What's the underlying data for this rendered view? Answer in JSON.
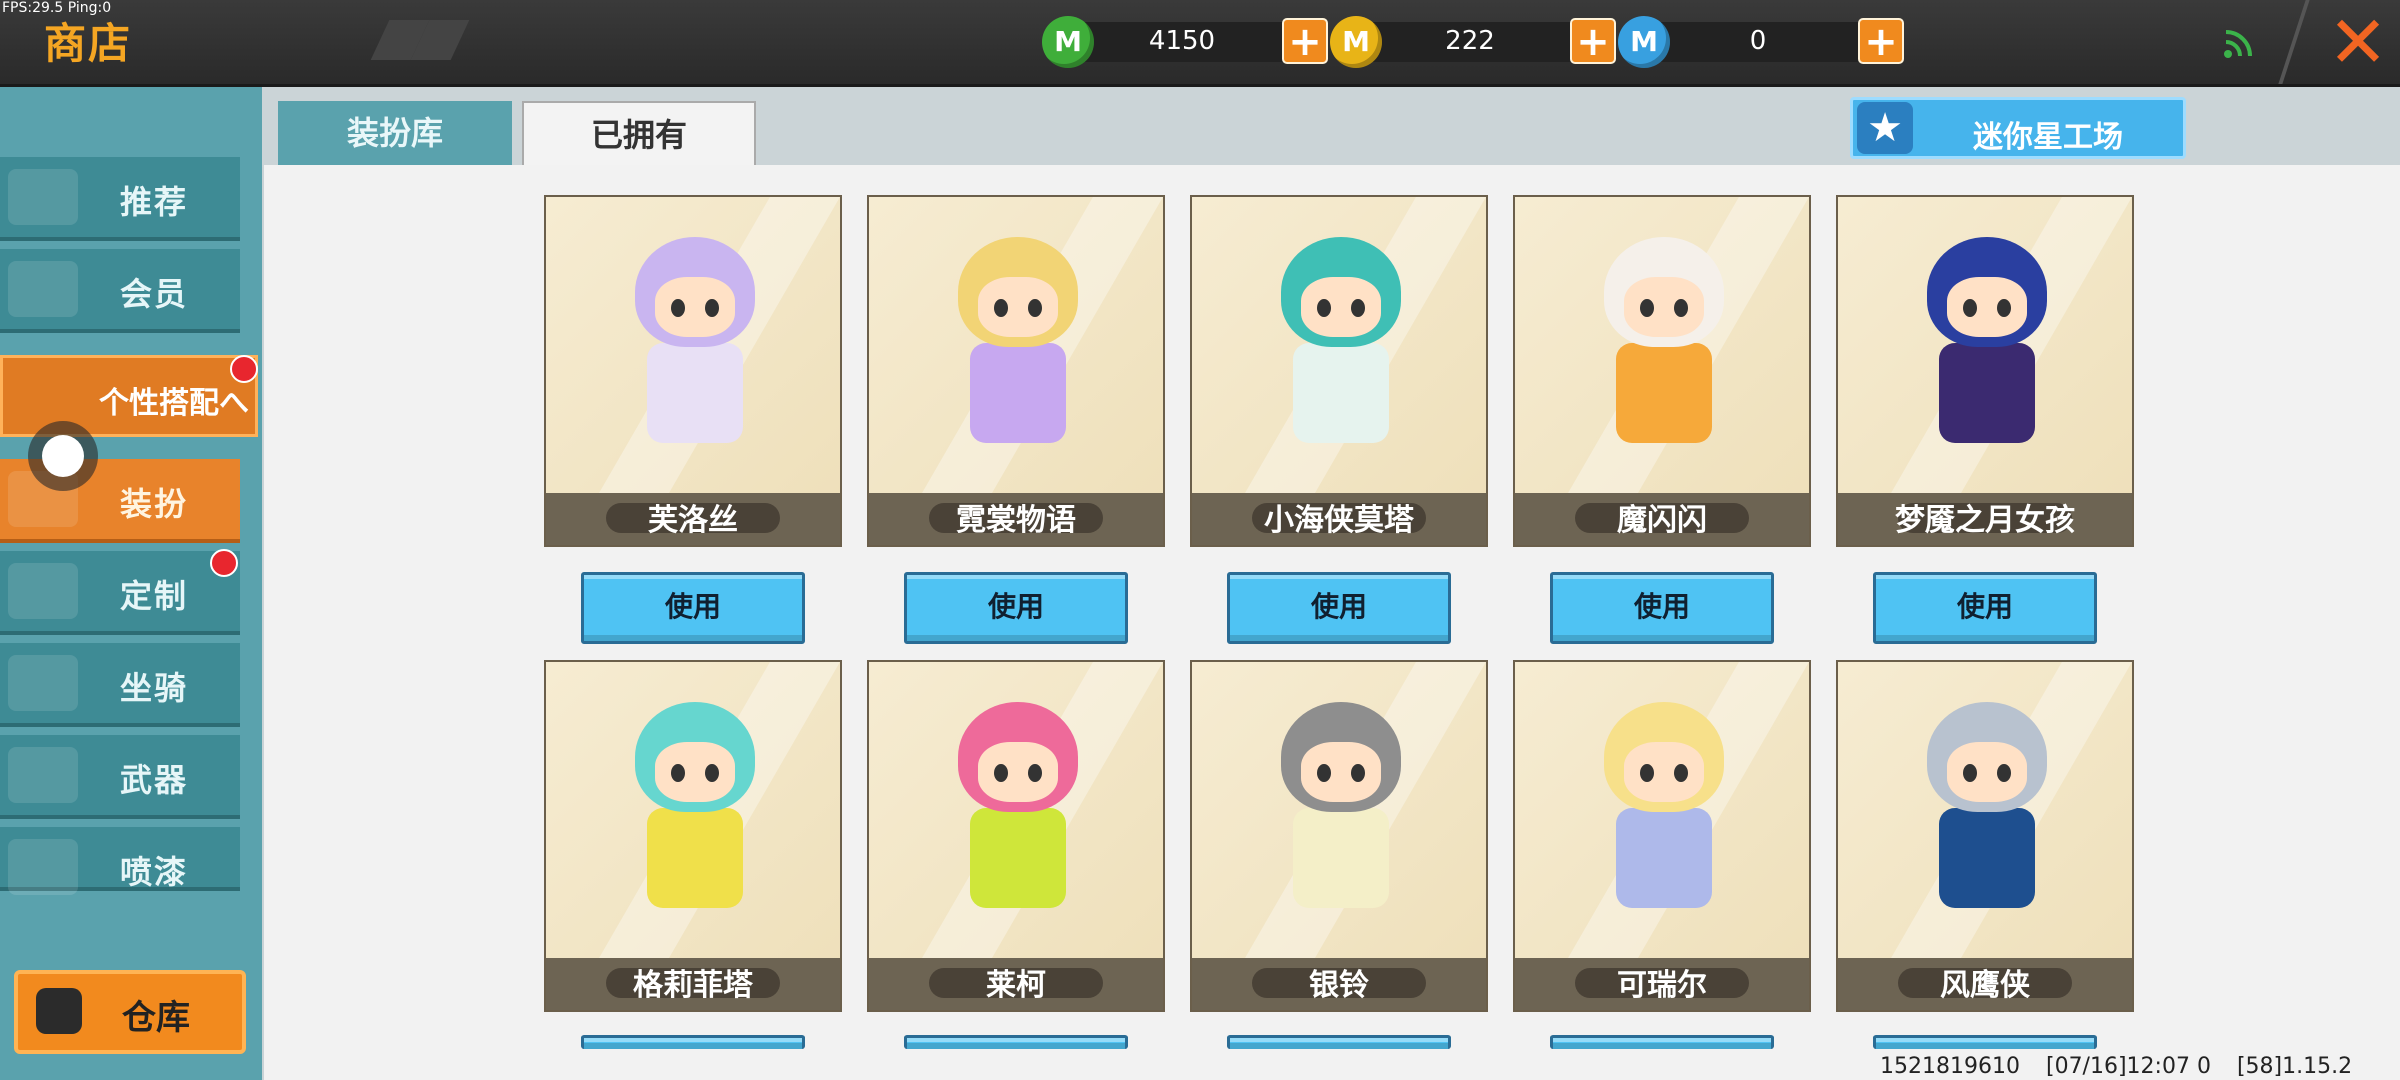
{
  "debug": {
    "fps_text": "FPS:29.5  Ping:0"
  },
  "header": {
    "title": "商店",
    "currencies": [
      {
        "name": "green-coin",
        "value": "4150",
        "color": "#3fae3a",
        "glyph": "M"
      },
      {
        "name": "gold-coin",
        "value": "222",
        "color": "#e8b417",
        "glyph": "M"
      },
      {
        "name": "blue-coin",
        "value": "0",
        "color": "#38a0e0",
        "glyph": "M"
      }
    ],
    "plus_glyph": "+",
    "close_glyph": "✕"
  },
  "sidebar": {
    "items": [
      {
        "label": "推荐"
      },
      {
        "label": "会员"
      },
      {
        "label": "装扮"
      },
      {
        "label": "定制"
      },
      {
        "label": "坐骑"
      },
      {
        "label": "武器"
      },
      {
        "label": "喷漆"
      }
    ],
    "group_label": "个性搭配へ",
    "warehouse_label": "仓库"
  },
  "tabs": {
    "wardrobe": "装扮库",
    "owned": "已拥有"
  },
  "workshop": {
    "label": "迷你星工场",
    "icon": "★"
  },
  "cards": [
    {
      "name": "芙洛丝",
      "hair": "#c9b5f0",
      "outfit": "#e8e0f5"
    },
    {
      "name": "霓裳物语",
      "hair": "#f2d475",
      "outfit": "#c7a8f0"
    },
    {
      "name": "小海侠莫塔",
      "hair": "#3fbfb5",
      "outfit": "#e6f3ee"
    },
    {
      "name": "魔闪闪",
      "hair": "#f5f0ea",
      "outfit": "#f6a93a"
    },
    {
      "name": "梦魇之月女孩",
      "hair": "#2a3fa0",
      "outfit": "#3b2a70"
    },
    {
      "name": "格莉菲塔",
      "hair": "#66d6cf",
      "outfit": "#f0e04a"
    },
    {
      "name": "莱柯",
      "hair": "#ee6a9a",
      "outfit": "#cfe63a"
    },
    {
      "name": "银铃",
      "hair": "#8e8e8e",
      "outfit": "#f4efc8"
    },
    {
      "name": "可瑞尔",
      "hair": "#f7e08a",
      "outfit": "#aeb9ea"
    },
    {
      "name": "风鹰侠",
      "hair": "#b8c2cf",
      "outfit": "#1e4f8f"
    }
  ],
  "use_label": "使用",
  "footer": {
    "uid": "1521819610",
    "time": "[07/16]12:07 0",
    "version": "[58]1.15.2"
  }
}
